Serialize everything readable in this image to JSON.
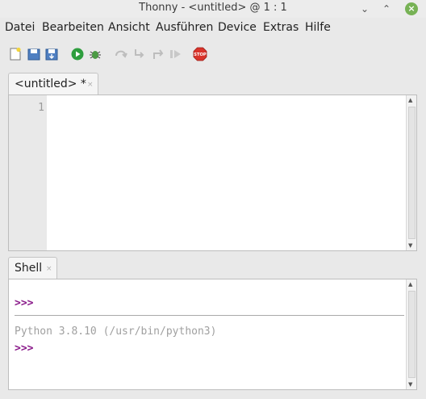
{
  "window": {
    "title": "Thonny - <untitled> @ 1 : 1"
  },
  "menu": [
    "Datei",
    "Bearbeiten",
    "Ansicht",
    "Ausführen",
    "Device",
    "Extras",
    "Hilfe"
  ],
  "editor": {
    "tab_label": "<untitled> *",
    "tab_close": "×",
    "line_numbers": [
      "1"
    ]
  },
  "shell": {
    "tab_label": "Shell",
    "tab_close": "×",
    "prompt": ">>>",
    "banner": "Python 3.8.10 (/usr/bin/python3)"
  },
  "toolbar": {
    "icons": [
      "new-file-icon",
      "open-file-icon",
      "save-file-icon",
      "run-icon",
      "debug-icon",
      "step-over-icon",
      "step-into-icon",
      "step-out-icon",
      "resume-icon",
      "stop-icon"
    ],
    "stop_label": "STOP",
    "colors": {
      "run": "#2e9e3e",
      "stop": "#d9342b"
    }
  }
}
